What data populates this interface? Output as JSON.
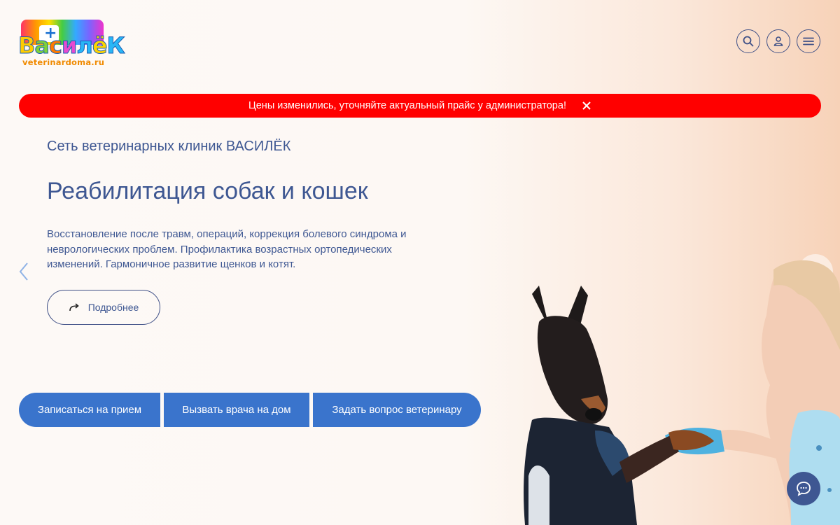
{
  "header": {
    "logo_text": "ВасилёК",
    "logo_url": "veterinardoma.ru",
    "icons": [
      "search-icon",
      "user-icon",
      "menu-icon"
    ]
  },
  "alert": {
    "text": "Цены изменились, уточняйте актуальный прайс у администратора!",
    "color": "#ff0000"
  },
  "hero": {
    "subtitle": "Сеть ветеринарных клиник ВАСИЛЁК",
    "title": "Реабилитация собак и кошек",
    "description": "Восстановление после травм, операций, коррекция болевого синдрома и неврологических проблем. Профилактика возрастных ортопедических изменений. Гармоничное развитие щенков и котят.",
    "more_label": "Подробнее"
  },
  "actions": [
    {
      "label": "Записаться на прием"
    },
    {
      "label": "Вызвать врача на дом"
    },
    {
      "label": "Задать вопрос ветеринару"
    }
  ],
  "colors": {
    "text": "#3e5792",
    "accent": "#3a74cc",
    "alert": "#ff0000"
  }
}
